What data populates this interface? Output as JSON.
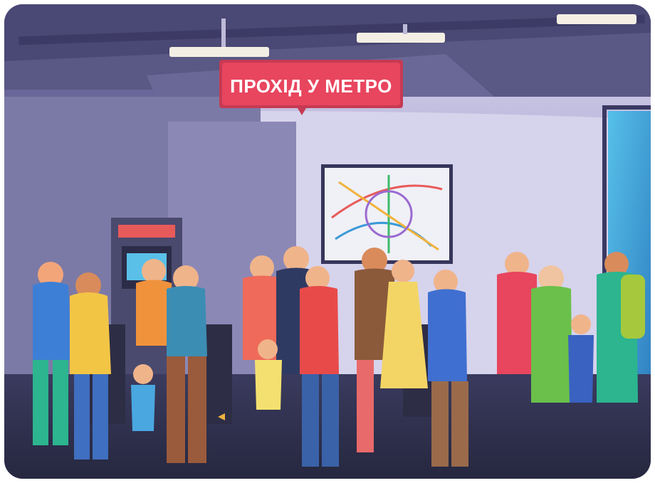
{
  "scene": {
    "sign_text": "ПРОХІД У МЕТРО",
    "colors": {
      "sign": "#e8455e",
      "ceiling": "#5b5a86",
      "wall": "#c9c6e4",
      "floor": "#2f3150",
      "map_bg": "#f0f0f7",
      "screen": "#44a7d9"
    },
    "icons": [
      "ceiling-lamp",
      "metro-map",
      "ticket-machine",
      "turnstile",
      "crowd"
    ]
  }
}
